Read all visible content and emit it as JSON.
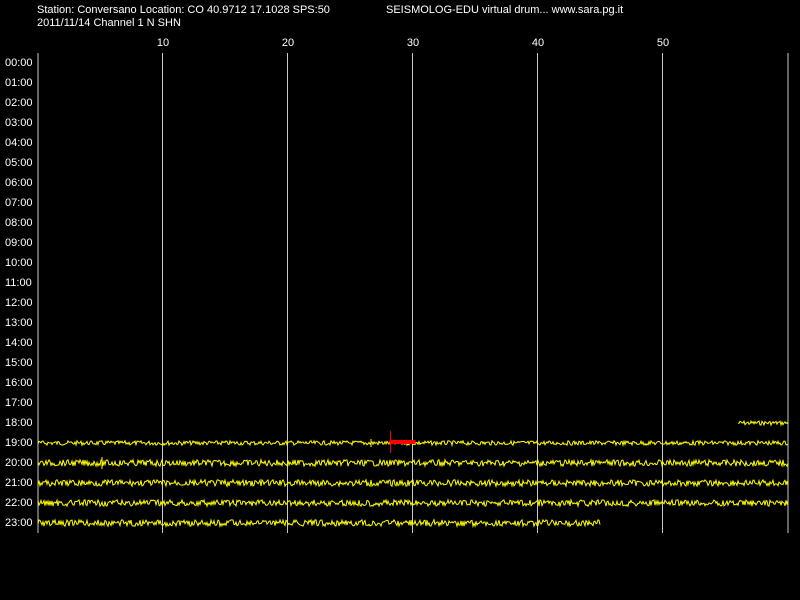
{
  "header": {
    "station_line": "Station: Conversano Location: CO 40.9712 17.1028 SPS:50",
    "app_line": "SEISMOLOG-EDU virtual drum... www.sara.pg.it",
    "date_line": "2011/11/14  Channel 1 N SHN"
  },
  "colors": {
    "background": "#000000",
    "trace": "#ffff00",
    "event_marker": "#ff0000",
    "gridline": "#c8c8c8",
    "text": "#ffffff"
  },
  "drum": {
    "minute_labels": [
      "10",
      "20",
      "30",
      "40",
      "50"
    ],
    "hour_labels": [
      "00:00",
      "01:00",
      "02:00",
      "03:00",
      "04:00",
      "05:00",
      "06:00",
      "07:00",
      "08:00",
      "09:00",
      "10:00",
      "11:00",
      "12:00",
      "13:00",
      "14:00",
      "15:00",
      "16:00",
      "17:00",
      "18:00",
      "19:00",
      "20:00",
      "21:00",
      "22:00",
      "23:00"
    ],
    "traces": [
      {
        "hour": "18:00",
        "start_min": 56,
        "end_min": 60,
        "amplitude": "low"
      },
      {
        "hour": "19:00",
        "start_min": 0,
        "end_min": 60,
        "amplitude": "low"
      },
      {
        "hour": "20:00",
        "start_min": 0,
        "end_min": 60,
        "amplitude": "medium"
      },
      {
        "hour": "21:00",
        "start_min": 0,
        "end_min": 60,
        "amplitude": "medium"
      },
      {
        "hour": "22:00",
        "start_min": 0,
        "end_min": 60,
        "amplitude": "medium"
      },
      {
        "hour": "23:00",
        "start_min": 0,
        "end_min": 45,
        "amplitude": "medium"
      }
    ],
    "event": {
      "hour": "19:00",
      "start_min": 28.1,
      "end_min": 30.2
    }
  }
}
